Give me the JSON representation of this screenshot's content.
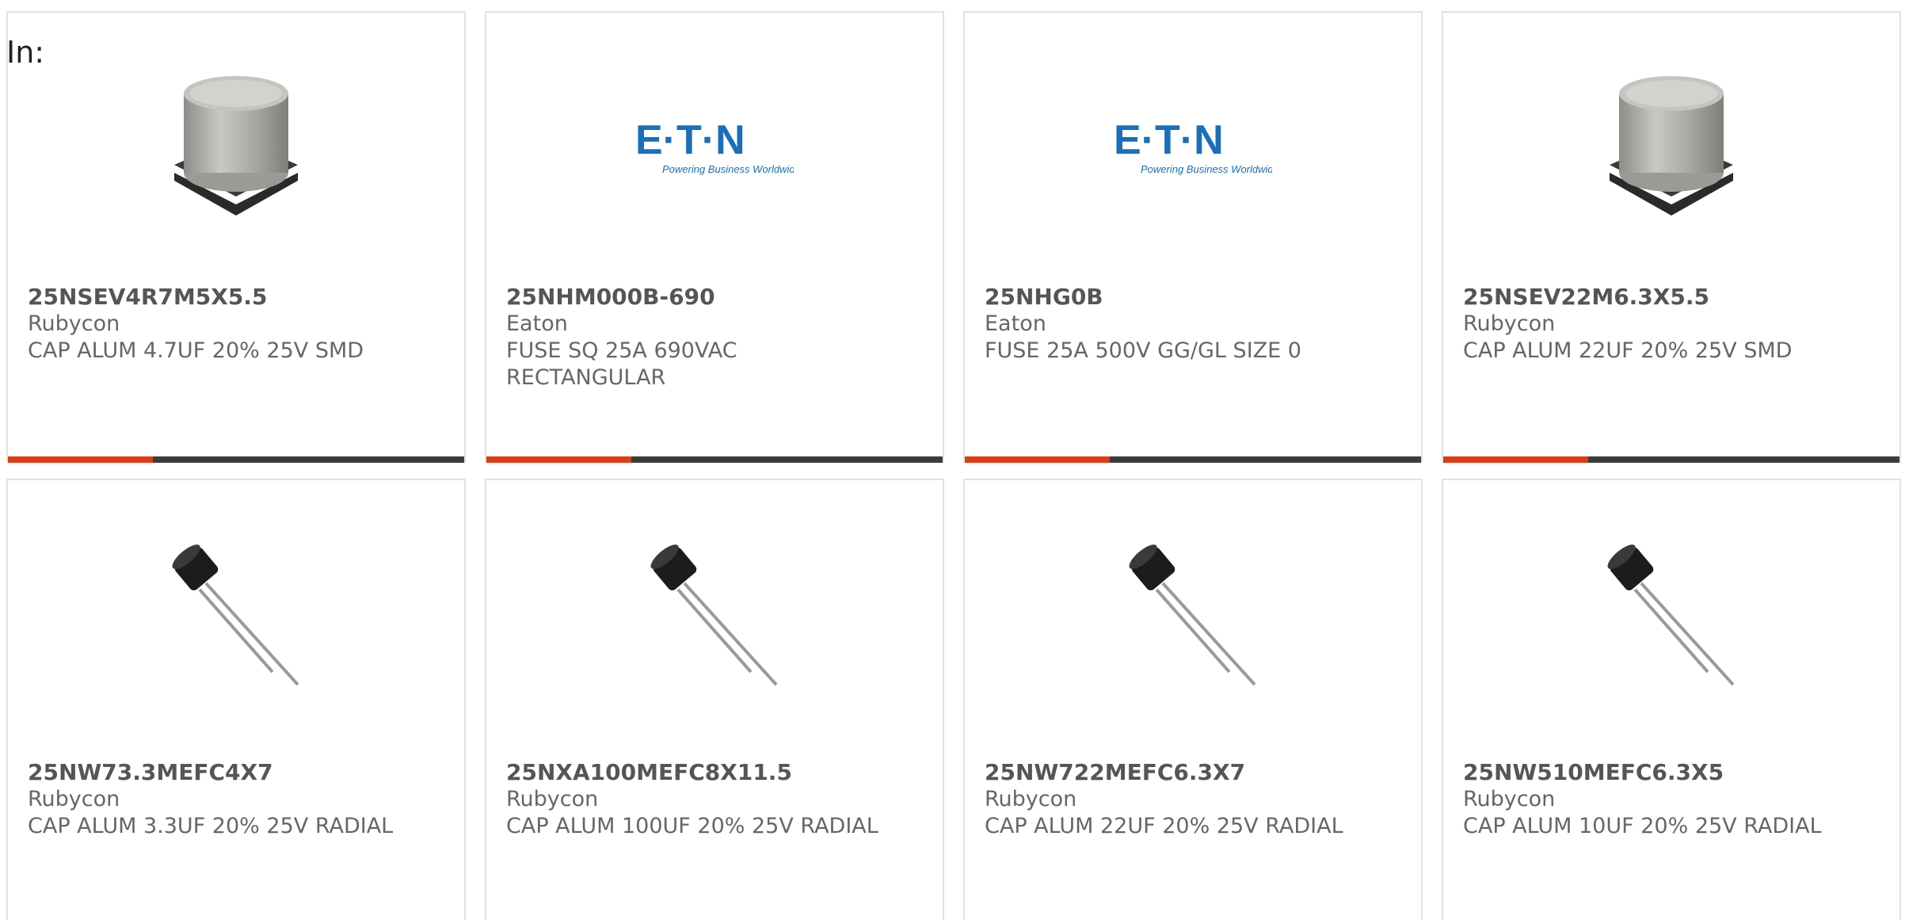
{
  "header": {
    "in_label": "In:"
  },
  "colors": {
    "accent": "#e23a12",
    "bar_track": "#3c3c3c",
    "border": "#e2e2e2",
    "text": "#666666"
  },
  "products": [
    {
      "part": "25NSEV4R7M5X5.5",
      "maker": "Rubycon",
      "desc": "CAP ALUM 4.7UF 20% 25V SMD",
      "image": "smd-capacitor-icon",
      "has_bar": true
    },
    {
      "part": "25NHM000B-690",
      "maker": "Eaton",
      "desc": "FUSE SQ 25A 690VAC RECTANGULAR",
      "image": "eaton-logo",
      "logo_text": "E·T·N",
      "logo_tagline": "Powering Business Worldwide",
      "has_bar": true
    },
    {
      "part": "25NHG0B",
      "maker": "Eaton",
      "desc": "FUSE 25A 500V GG/GL SIZE 0",
      "image": "eaton-logo",
      "logo_text": "E·T·N",
      "logo_tagline": "Powering Business Worldwide",
      "has_bar": true
    },
    {
      "part": "25NSEV22M6.3X5.5",
      "maker": "Rubycon",
      "desc": "CAP ALUM 22UF 20% 25V SMD",
      "image": "smd-capacitor-icon",
      "has_bar": true
    },
    {
      "part": "25NW73.3MEFC4X7",
      "maker": "Rubycon",
      "desc": "CAP ALUM 3.3UF 20% 25V RADIAL",
      "image": "radial-capacitor-icon",
      "has_bar": false
    },
    {
      "part": "25NXA100MEFC8X11.5",
      "maker": "Rubycon",
      "desc": "CAP ALUM 100UF 20% 25V RADIAL",
      "image": "radial-capacitor-icon",
      "has_bar": false
    },
    {
      "part": "25NW722MEFC6.3X7",
      "maker": "Rubycon",
      "desc": "CAP ALUM 22UF 20% 25V RADIAL",
      "image": "radial-capacitor-icon",
      "has_bar": false
    },
    {
      "part": "25NW510MEFC6.3X5",
      "maker": "Rubycon",
      "desc": "CAP ALUM 10UF 20% 25V RADIAL",
      "image": "radial-capacitor-icon",
      "has_bar": false
    }
  ]
}
